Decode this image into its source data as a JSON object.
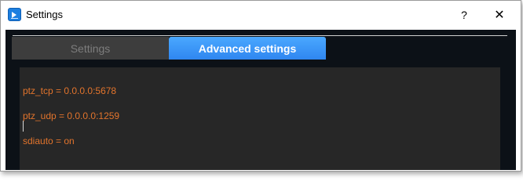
{
  "window": {
    "title": "Settings",
    "help_label": "?",
    "close_label": "✕"
  },
  "tabs": [
    {
      "label": "Settings",
      "active": false
    },
    {
      "label": "Advanced settings",
      "active": true
    }
  ],
  "editor": {
    "lines": [
      "ptz_tcp = 0.0.0.0:5678",
      "ptz_udp = 0.0.0.0:1259",
      "sdiauto = on"
    ]
  },
  "colors": {
    "content_bg": "#0c1117",
    "editor_bg": "#272727",
    "text_orange": "#e2742c",
    "tab_active": "#3a95f6",
    "tab_inactive": "#3d3d3d"
  }
}
